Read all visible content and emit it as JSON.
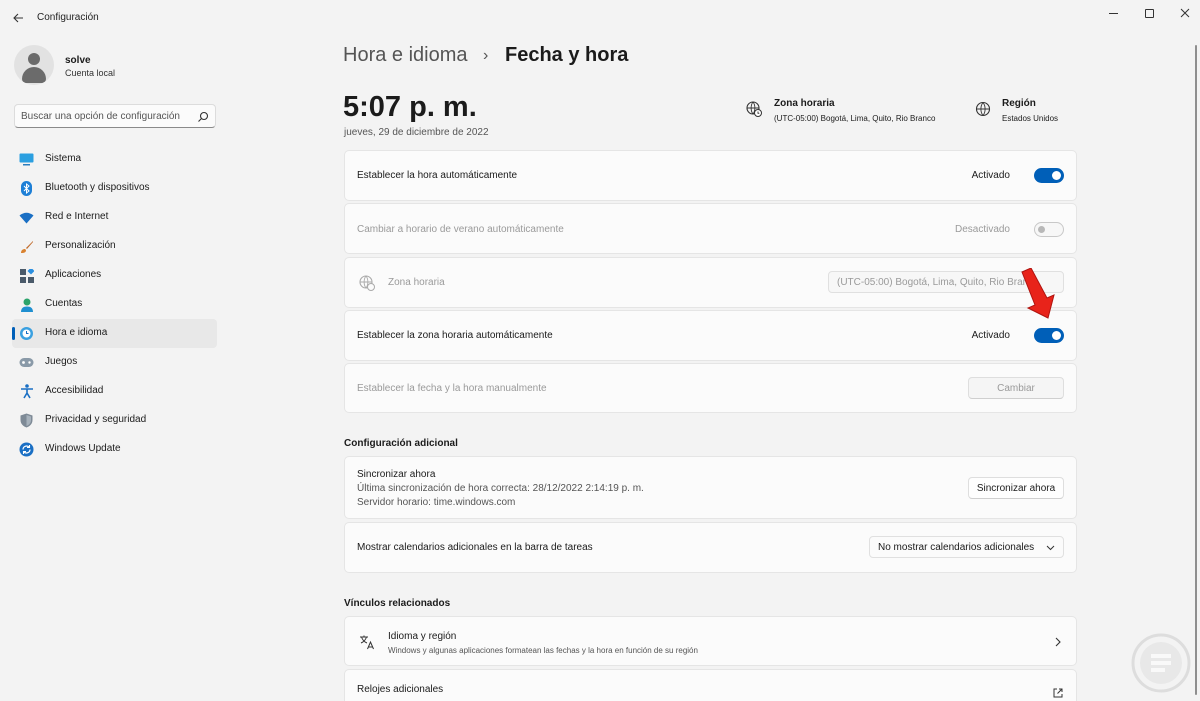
{
  "window": {
    "title": "Configuración"
  },
  "profile": {
    "name": "solve",
    "account_type": "Cuenta local"
  },
  "search": {
    "placeholder": "Buscar una opción de configuración"
  },
  "sidebar": {
    "items": [
      {
        "label": "Sistema",
        "icon": "monitor-icon"
      },
      {
        "label": "Bluetooth y dispositivos",
        "icon": "bluetooth-icon"
      },
      {
        "label": "Red e Internet",
        "icon": "wifi-icon"
      },
      {
        "label": "Personalización",
        "icon": "brush-icon"
      },
      {
        "label": "Aplicaciones",
        "icon": "apps-icon"
      },
      {
        "label": "Cuentas",
        "icon": "person-icon"
      },
      {
        "label": "Hora e idioma",
        "icon": "globe-clock-icon",
        "active": true
      },
      {
        "label": "Juegos",
        "icon": "gamepad-icon"
      },
      {
        "label": "Accesibilidad",
        "icon": "accessibility-icon"
      },
      {
        "label": "Privacidad y seguridad",
        "icon": "shield-icon"
      },
      {
        "label": "Windows Update",
        "icon": "update-icon"
      }
    ]
  },
  "breadcrumb": {
    "parent": "Hora e idioma",
    "separator": "›",
    "current": "Fecha y hora"
  },
  "clock": {
    "time": "5:07 p. m.",
    "date": "jueves, 29 de diciembre de 2022"
  },
  "timezone_info": {
    "title": "Zona horaria",
    "value": "(UTC-05:00) Bogotá, Lima, Quito, Rio Branco"
  },
  "region_info": {
    "title": "Región",
    "value": "Estados Unidos"
  },
  "settings": {
    "auto_time": {
      "label": "Establecer la hora automáticamente",
      "state": "Activado",
      "on": true
    },
    "dst": {
      "label": "Cambiar a horario de verano automáticamente",
      "state": "Desactivado",
      "on": false
    },
    "timezone": {
      "label": "Zona horaria",
      "value": "(UTC-05:00) Bogotá, Lima, Quito, Rio Branco"
    },
    "auto_timezone": {
      "label": "Establecer la zona horaria automáticamente",
      "state": "Activado",
      "on": true
    },
    "manual": {
      "label": "Establecer la fecha y la hora manualmente",
      "button": "Cambiar"
    }
  },
  "additional": {
    "heading": "Configuración adicional",
    "sync": {
      "title": "Sincronizar ahora",
      "last_sync": "Última sincronización de hora correcta: 28/12/2022 2:14:19 p. m.",
      "server": "Servidor horario: time.windows.com",
      "button": "Sincronizar ahora"
    },
    "calendars": {
      "label": "Mostrar calendarios adicionales en la barra de tareas",
      "value": "No mostrar calendarios adicionales"
    }
  },
  "related": {
    "heading": "Vínculos relacionados",
    "language_region": {
      "title": "Idioma y región",
      "desc": "Windows y algunas aplicaciones formatean las fechas y la hora en función de su región"
    },
    "extra_clocks": {
      "title": "Relojes adicionales"
    }
  },
  "colors": {
    "accent": "#005fb8",
    "annotation_arrow": "#e8231a"
  }
}
